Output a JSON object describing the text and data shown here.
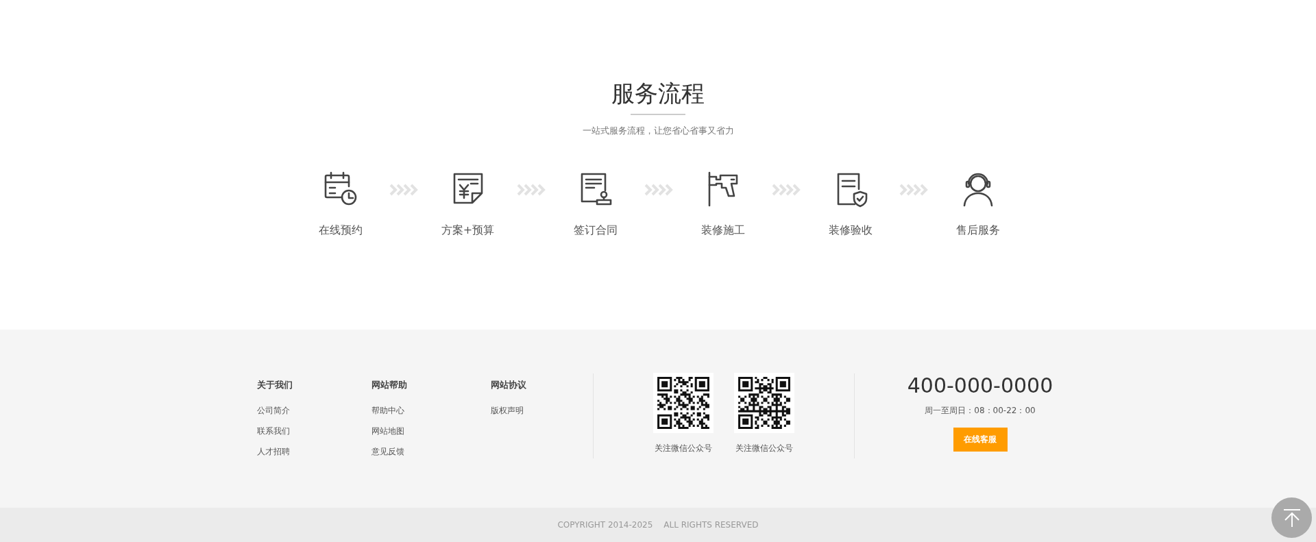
{
  "service": {
    "title": "服务流程",
    "subtitle": "一站式服务流程，让您省心省事又省力"
  },
  "steps": [
    {
      "kind": "calendar",
      "label": "在线预约"
    },
    {
      "kind": "quote",
      "label": "方案+预算"
    },
    {
      "kind": "contract",
      "label": "签订合同"
    },
    {
      "kind": "drill",
      "label": "装修施工"
    },
    {
      "kind": "inspection",
      "label": "装修验收"
    },
    {
      "kind": "support",
      "label": "售后服务"
    }
  ],
  "footer": {
    "link_columns": [
      {
        "heading": "关于我们",
        "links": [
          "公司简介",
          "联系我们",
          "人才招聘"
        ]
      },
      {
        "heading": "网站帮助",
        "links": [
          "帮助中心",
          "网站地图",
          "意见反馈"
        ]
      },
      {
        "heading": "网站协议",
        "links": [
          "版权声明"
        ]
      }
    ],
    "qr_codes": [
      {
        "caption": "关注微信公众号"
      },
      {
        "caption": "关注微信公众号"
      }
    ],
    "contact": {
      "phone": "400-000-0000",
      "hours": "周一至周日：08：00-22：00",
      "button": "在线客服"
    },
    "copyright": [
      "COPYRIGHT 2014-2025",
      "ALL RIGHTS RESERVED"
    ]
  }
}
